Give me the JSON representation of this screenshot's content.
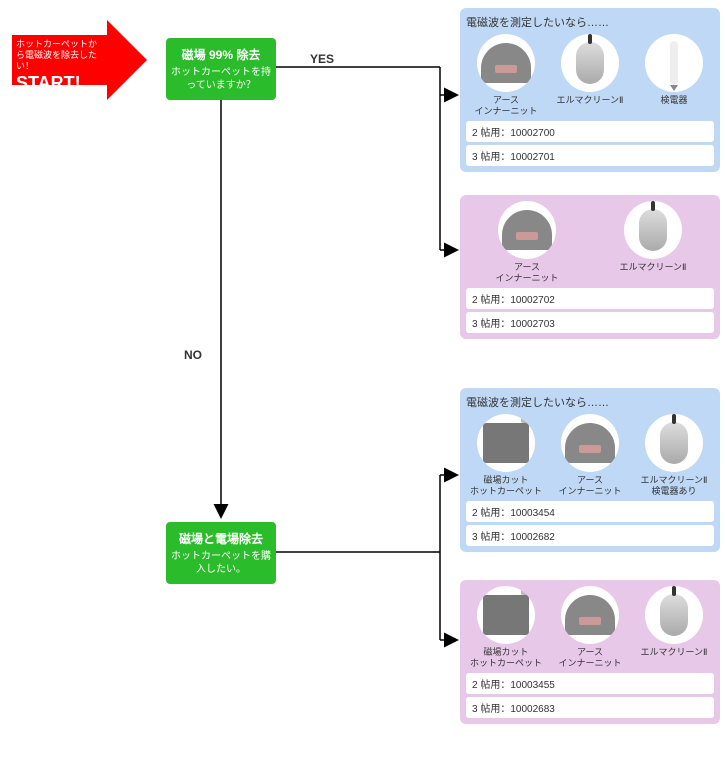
{
  "start": {
    "line1": "ホットカーペットから電磁波を除去したい！",
    "line2": "START!"
  },
  "node1": {
    "title": "磁場 99% 除去",
    "sub": "ホットカーペットを持っていますか？"
  },
  "node2": {
    "title": "磁場と電場除去",
    "sub": "ホットカーペットを購入したい。"
  },
  "labels": {
    "yes": "YES",
    "no": "NO"
  },
  "panels": {
    "p1": {
      "header": "電磁波を測定したいなら……",
      "prods": [
        {
          "name": "アース\nインナーニット",
          "icon": "knit"
        },
        {
          "name": "エルマクリーンⅡ",
          "icon": "mouse"
        },
        {
          "name": "検電器",
          "icon": "pen"
        }
      ],
      "skus": [
        "2 帖用：10002700",
        "3 帖用：10002701"
      ]
    },
    "p2": {
      "prods": [
        {
          "name": "アース\nインナーニット",
          "icon": "knit"
        },
        {
          "name": "エルマクリーンⅡ",
          "icon": "mouse"
        }
      ],
      "skus": [
        "2 帖用：10002702",
        "3 帖用：10002703"
      ]
    },
    "p3": {
      "header": "電磁波を測定したいなら……",
      "prods": [
        {
          "name": "磁場カット\nホットカーペット",
          "icon": "carpet"
        },
        {
          "name": "アース\nインナーニット",
          "icon": "knit"
        },
        {
          "name": "エルマクリーンⅡ\n検電器あり",
          "icon": "mouse"
        }
      ],
      "skus": [
        "2 帖用：10003454",
        "3 帖用：10002682"
      ]
    },
    "p4": {
      "prods": [
        {
          "name": "磁場カット\nホットカーペット",
          "icon": "carpet"
        },
        {
          "name": "アース\nインナーニット",
          "icon": "knit"
        },
        {
          "name": "エルマクリーンⅡ",
          "icon": "mouse"
        }
      ],
      "skus": [
        "2 帖用：10003455",
        "3 帖用：10002683"
      ]
    }
  }
}
